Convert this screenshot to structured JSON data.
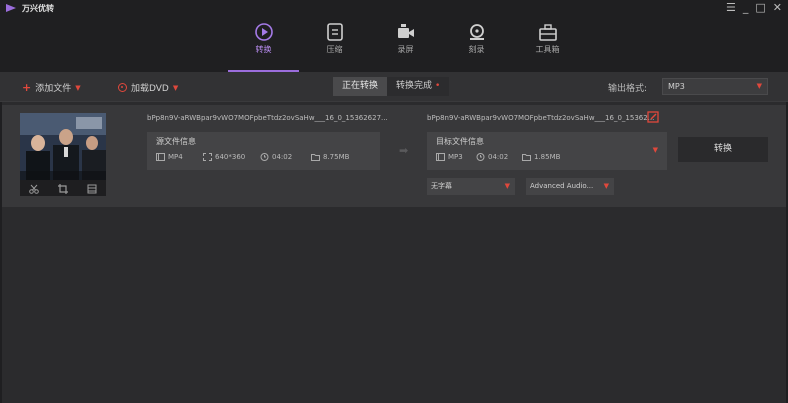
{
  "app": {
    "title": "万兴优转",
    "window_controls": [
      "☰",
      "_",
      "□",
      "✕"
    ]
  },
  "nav": {
    "items": [
      {
        "label": "转换",
        "icon": "convert-icon",
        "active": true
      },
      {
        "label": "压缩",
        "icon": "compress-icon",
        "active": false
      },
      {
        "label": "录屏",
        "icon": "record-screen-icon",
        "active": false
      },
      {
        "label": "刻录",
        "icon": "burn-disc-icon",
        "active": false
      },
      {
        "label": "工具箱",
        "icon": "toolbox-icon",
        "active": false
      }
    ]
  },
  "toolbar": {
    "add_file_label": "添加文件",
    "load_dvd_label": "加载DVD",
    "tabs": [
      {
        "label": "正在转换",
        "active": true
      },
      {
        "label": "转换完成",
        "active": false,
        "has_dot": true
      }
    ],
    "output_format_label": "输出格式:",
    "output_format_value": "MP3"
  },
  "file": {
    "source_name": "bPp8n9V-aRWBpar9vWO7MOFpbeTtdz2ovSaHw___16_0_15362627...",
    "source_info_title": "源文件信息",
    "source_format": "MP4",
    "source_resolution": "640*360",
    "source_duration": "04:02",
    "source_size": "8.75MB",
    "target_name": "bPp8n9V-aRWBpar9vWO7MOFpbeTtdz2ovSaHw___16_0_15362...",
    "target_info_title": "目标文件信息",
    "target_format": "MP3",
    "target_duration": "04:02",
    "target_size": "1.85MB",
    "convert_label": "转换",
    "subtitle_select": "无字幕",
    "audio_select": "Advanced Audio..."
  },
  "colors": {
    "accent_purple": "#9b6ddc",
    "accent_red": "#e0483c",
    "background": "#2b2b2d",
    "card": "#38383a"
  }
}
